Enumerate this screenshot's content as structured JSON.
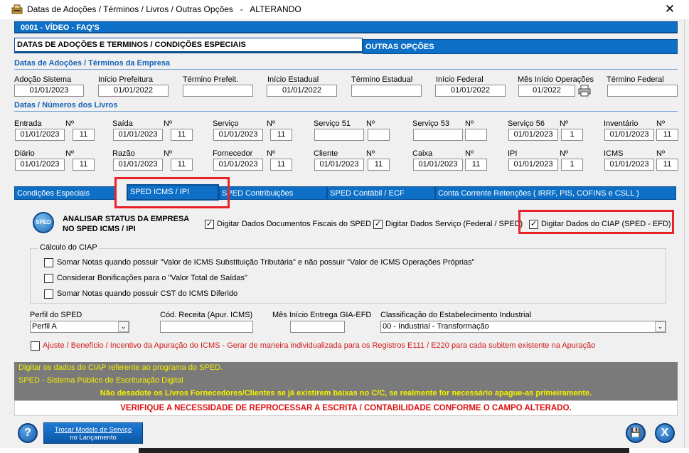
{
  "window": {
    "title": "Datas de Adoções / Términos / Livros / Outras Opções   -   ALTERANDO",
    "close": "✕"
  },
  "header": {
    "record": "0001    -    VÍDEO - FAQ'S"
  },
  "tabs_top": {
    "active": "DATAS DE ADOÇÕES E TERMINOS / CONDIÇÕES ESPECIAIS",
    "other": "OUTRAS OPÇÕES"
  },
  "section1": {
    "title": "Datas de Adoções / Términos da Empresa",
    "fields": [
      {
        "label": "Adoção Sistema",
        "value": "01/01/2023"
      },
      {
        "label": "Início Prefeitura",
        "value": "01/01/2022"
      },
      {
        "label": "Término Prefeit.",
        "value": ""
      },
      {
        "label": "Início Estadual",
        "value": "01/01/2022"
      },
      {
        "label": "Término Estadual",
        "value": ""
      },
      {
        "label": "Início Federal",
        "value": "01/01/2022"
      },
      {
        "label": "Mês Início Operações",
        "value": "01/2022"
      },
      {
        "label": "Término Federal",
        "value": ""
      }
    ]
  },
  "section2": {
    "title": "Datas / Números dos Livros",
    "row1": [
      {
        "label": "Entrada",
        "date": "01/01/2023",
        "n_label": "Nº",
        "n": "11"
      },
      {
        "label": "Saída",
        "date": "01/01/2023",
        "n_label": "Nº",
        "n": "11"
      },
      {
        "label": "Serviço",
        "date": "01/01/2023",
        "n_label": "Nº",
        "n": "11"
      },
      {
        "label": "Serviço 51",
        "date": "",
        "n_label": "Nº",
        "n": ""
      },
      {
        "label": "Serviço 53",
        "date": "",
        "n_label": "Nº",
        "n": ""
      },
      {
        "label": "Serviço 56",
        "date": "01/01/2023",
        "n_label": "Nº",
        "n": "1"
      },
      {
        "label": "Inventário",
        "date": "01/01/2023",
        "n_label": "Nº",
        "n": "11"
      }
    ],
    "row2": [
      {
        "label": "Diário",
        "date": "01/01/2023",
        "n_label": "Nº",
        "n": "11"
      },
      {
        "label": "Razão",
        "date": "01/01/2023",
        "n_label": "Nº",
        "n": "11"
      },
      {
        "label": "Fornecedor",
        "date": "01/01/2023",
        "n_label": "Nº",
        "n": "11"
      },
      {
        "label": "Cliente",
        "date": "01/01/2023",
        "n_label": "Nº",
        "n": "11"
      },
      {
        "label": "Caixa",
        "date": "01/01/2023",
        "n_label": "Nº",
        "n": "11"
      },
      {
        "label": "IPI",
        "date": "01/01/2023",
        "n_label": "Nº",
        "n": "1"
      },
      {
        "label": "ICMS",
        "date": "01/01/2023",
        "n_label": "Nº",
        "n": "11"
      }
    ]
  },
  "subtabs": [
    "Condições Especiais",
    "SPED ICMS / IPI",
    "SPED Contribuições",
    "SPED Contábil / ECF",
    "Conta Corrente Retenções ( IRRF, PIS, COFINS e CSLL )"
  ],
  "sped": {
    "icon_text": "SPED",
    "analyze_line1": "ANALISAR STATUS DA EMPRESA",
    "analyze_line2": "NO SPED ICMS / IPI",
    "chk_fiscais": "Digitar Dados Documentos Fiscais do SPED",
    "chk_servico": "Digitar Dados Serviço (Federal / SPED)",
    "chk_ciap": "Digitar Dados do CIAP (SPED - EFD)",
    "ciap_group": "Cálculo do CIAP",
    "ciap_opts": [
      "Somar Notas quando possuir \"Valor de ICMS Substituição Tributária\" e não possuir \"Valor de ICMS Operações Próprias\"",
      "Considerar Bonificações para o \"Valor Total de Saídas\"",
      "Somar Notas quando possuir CST do ICMS Diferido"
    ],
    "perfil_label": "Perfil do SPED",
    "perfil_value": "Perfil A",
    "cod_receita_label": "Cód. Receita (Apur. ICMS)",
    "cod_receita_value": "",
    "mes_gia_label": "Mês Início Entrega GIA-EFD",
    "mes_gia_value": "",
    "classif_label": "Classificação do Estabelecimento Industrial",
    "classif_value": "00 - Industrial - Transformação",
    "ajuste": "Ajuste / Benefício / Incentivo da Apuração do ICMS - Gerar de maneira individualizada para os Registros E111 / E220 para cada subitem existente na Apuração"
  },
  "messages": {
    "hint1": "Digitar os dados do CIAP referente ao programa do SPED.",
    "hint2": "SPED - Sistema Público de Escrituração Digital",
    "warn1": "Não desadote os Livros Fornecedores/Clientes se já existirem baixas no C/C, se realmente for necessário apague-as primeiramente.",
    "warn2": "VERIFIQUE A NECESSIDADE DE REPROCESSAR A ESCRITA / CONTABILIDADE CONFORME O CAMPO ALTERADO."
  },
  "buttons": {
    "help": "?",
    "trocar_line1": "Trocar Modelo de Serviço",
    "trocar_line2": "no Lançamento",
    "save": "💾",
    "exit": "X"
  }
}
